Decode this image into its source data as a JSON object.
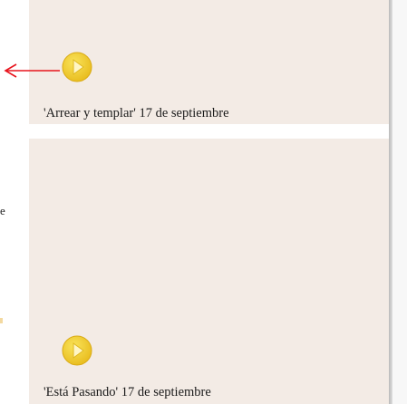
{
  "colors": {
    "panel": "#f3ebe5",
    "divider": "#ffffff",
    "play_button": "#f2cf2e",
    "play_glyph": "#fff6c4",
    "arrow": "#e8141d"
  },
  "icons": {
    "pointer": "left-arrow-icon",
    "play": "play-icon"
  },
  "left_edge": {
    "glyph": "e"
  },
  "items": [
    {
      "caption": "'Arrear y templar' 17 de septiembre"
    },
    {
      "caption": "'Está Pasando' 17 de septiembre"
    }
  ]
}
